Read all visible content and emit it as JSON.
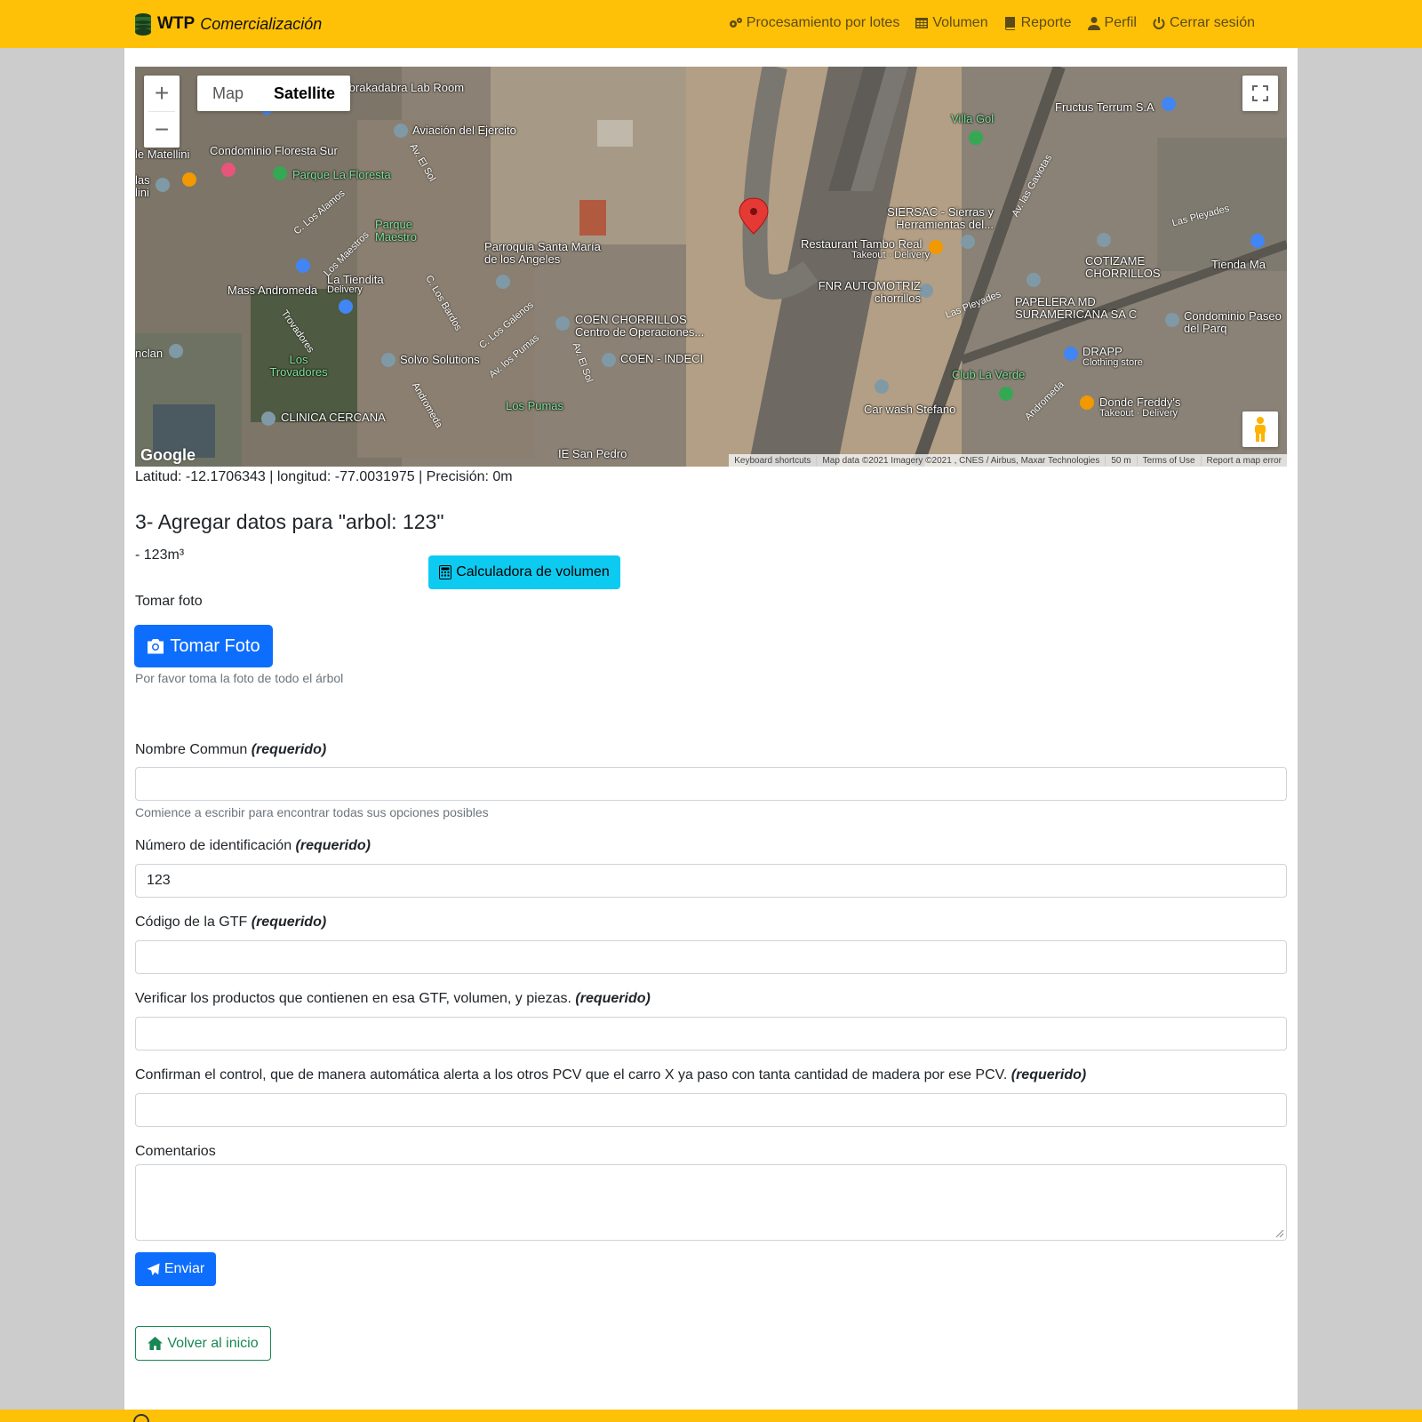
{
  "navbar": {
    "brand_strong": "WTP",
    "brand_em": "Comercialización",
    "items": [
      {
        "label": "Procesamiento por lotes",
        "icon": "gears-icon"
      },
      {
        "label": "Volumen",
        "icon": "table-icon"
      },
      {
        "label": "Reporte",
        "icon": "book-icon"
      },
      {
        "label": "Perfil",
        "icon": "user-icon"
      },
      {
        "label": "Cerrar sesión",
        "icon": "power-icon"
      }
    ]
  },
  "map": {
    "zoom_in": "+",
    "zoom_out": "−",
    "type_map": "Map",
    "type_satellite": "Satellite",
    "google": "Google",
    "attrib": [
      "Keyboard shortcuts",
      "Map data ©2021 Imagery ©2021 , CNES / Airbus, Maxar Technologies",
      "50 m",
      "Terms of Use",
      "Report a map error"
    ],
    "labels": {
      "abrakadabra": "Abrakadabra Lab Room",
      "aviacion": "Aviación del Ejercito",
      "floresta_sur": "Condominio Floresta Sur",
      "parque_floresta": "Parque La Floresta",
      "matellini": "le Matellini",
      "parque_maestro": "Parque Maestro",
      "parroquia": "Parroquia Santa María de los Ángeles",
      "la_tiendita": "La Tiendita",
      "mass_andromeda": "Mass Andromeda",
      "delivery": "Delivery",
      "coen": "COEN CHORRILLOS",
      "coen_sub": "Centro de Operaciones...",
      "coen_indeci": "COEN - INDECI",
      "solvo": "Solvo Solutions",
      "los_trovadores": "Los Trovadores",
      "los_pumas": "Los Pumas",
      "clinica": "CLINICA CERCANA",
      "ie_san_pedro": "IE San Pedro",
      "villa_gol": "Villa Gol",
      "fructus": "Fructus Terrum S.A",
      "siersac": "SIERSAC - Sierras y Herramientas del...",
      "tambo": "Restaurant Tambo Real",
      "takeout_delivery": "Takeout · Delivery",
      "fnr": "FNR AUTOMOTRIZ chorrillos",
      "cotizame": "COTIZAME CHORRILLOS",
      "papelera": "PAPELERA MD SURAMERICANA SA C",
      "tienda": "Tienda Ma",
      "condominio_paseo": "Condominio Paseo del Parq",
      "drapp": "DRAPP",
      "clothing": "Clothing store",
      "club_verde": "Club La Verde",
      "car_wash": "Car wash Stefano",
      "donde_freddy": "Donde Freddy's",
      "nclan": "nclan",
      "las_lini": "las lini",
      "av_el_sol": "Av. El Sol",
      "av_los_pumas": "Av. los Pumas",
      "andromeda": "Andromeda",
      "las_pleyades": "Las Pleyades",
      "av_gaviotas": "Av. las Gaviotas",
      "los_alamos": "C. Los Alamos",
      "los_maestros": "Los Maestros",
      "los_bardos": "C. Los Bardos",
      "los_galenos": "C. Los Galenos",
      "trovadores": "Trovadores"
    }
  },
  "coords_text": "Latitud: -12.1706343 | longitud: -77.0031975 | Precisión: 0m",
  "section_title": "3- Agregar datos para \"arbol: 123\"",
  "volume_text": "- 123m³",
  "volume_button": "Calculadora de volumen",
  "photo": {
    "label": "Tomar foto",
    "button": "Tomar Foto",
    "help": "Por favor toma la foto de todo el árbol"
  },
  "required_tag": "(requerido)",
  "fields": {
    "nombre": {
      "label": "Nombre Commun",
      "value": "",
      "help": "Comience a escribir para encontrar todas sus opciones posibles"
    },
    "numero": {
      "label": "Número de identificación",
      "value": "123"
    },
    "codigo": {
      "label": "Código de la GTF",
      "value": ""
    },
    "verificar": {
      "label": "Verificar los productos que contienen en esa GTF, volumen, y piezas.",
      "value": ""
    },
    "confirman": {
      "label": "Confirman el control, que de manera automática alerta a los otros PCV que el carro X ya paso con tanta cantidad de madera por ese PCV.",
      "value": ""
    },
    "comentarios": {
      "label": "Comentarios",
      "value": ""
    }
  },
  "send_button": "Enviar",
  "back_button": "Volver al inicio",
  "colors": {
    "navbar": "#ffc107",
    "primary": "#0d6efd",
    "info": "#0dcaf0",
    "success": "#198754",
    "page_bg": "#cccccc"
  }
}
